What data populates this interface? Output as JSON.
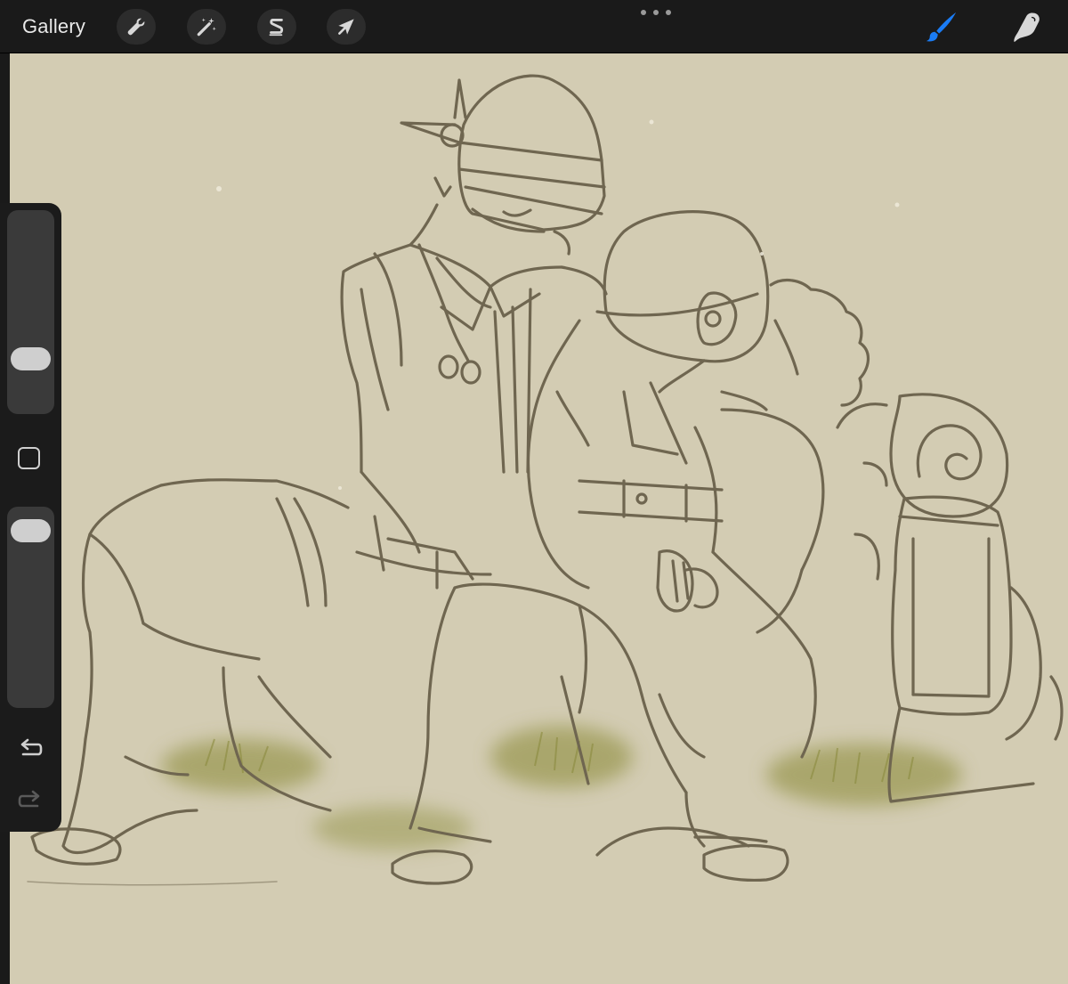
{
  "toolbar": {
    "gallery_label": "Gallery",
    "tools": [
      {
        "name": "actions",
        "icon": "wrench-icon"
      },
      {
        "name": "adjustments",
        "icon": "magic-wand-icon"
      },
      {
        "name": "selection",
        "icon": "selection-s-icon"
      },
      {
        "name": "transform",
        "icon": "arrow-cursor-icon"
      }
    ],
    "more_icon": "more-dots-icon",
    "right_tools": [
      {
        "name": "brush",
        "icon": "brush-icon",
        "active": true
      },
      {
        "name": "smudge",
        "icon": "smudge-finger-icon",
        "active": false
      }
    ],
    "active_color": "#1a7cf5"
  },
  "sidebar": {
    "brush_size_fraction": 0.23,
    "brush_opacity_fraction": 0.95,
    "modify_icon": "square-modify-icon",
    "undo_icon": "undo-icon",
    "redo_icon": "redo-icon"
  },
  "canvas": {
    "background_color": "#d3ccb3",
    "line_color": "#6f6650",
    "grass_color": "#8a8a3e",
    "content": "sketch-artwork"
  }
}
